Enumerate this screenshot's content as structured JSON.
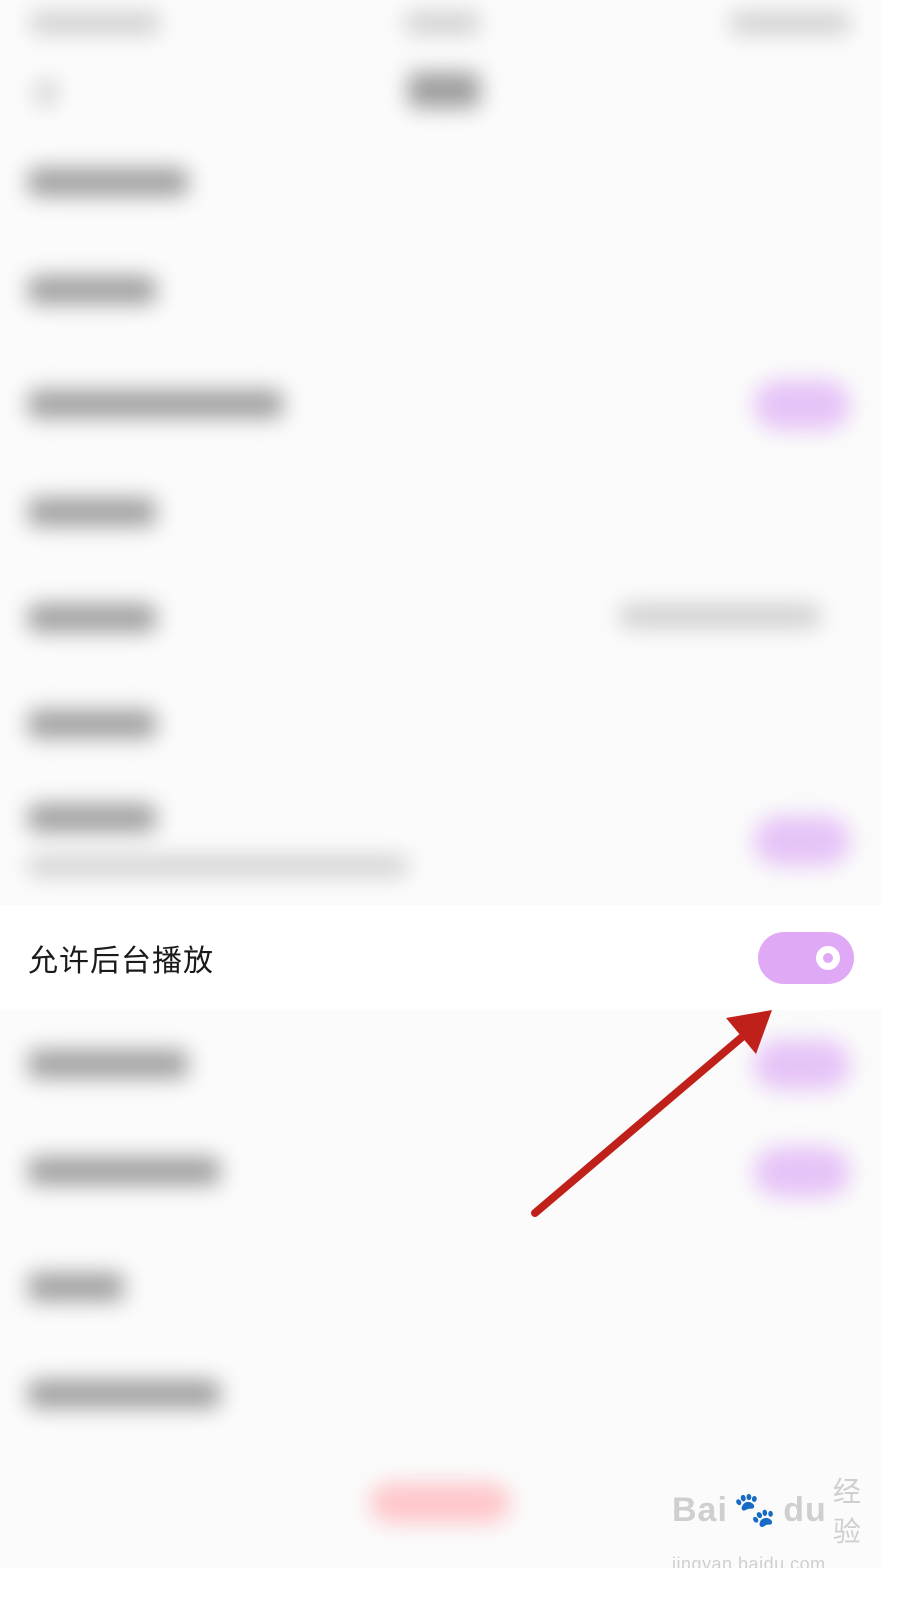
{
  "setting_row": {
    "label": "允许后台播放",
    "toggle_on": true
  },
  "colors": {
    "toggle_accent": "#e0a9f6",
    "arrow": "#c0201a",
    "background": "#fbfbfb"
  },
  "watermark": {
    "brand": "Bai",
    "brand_suffix": "du",
    "brand_cn": "经验",
    "url": "jingyan.baidu.com"
  }
}
